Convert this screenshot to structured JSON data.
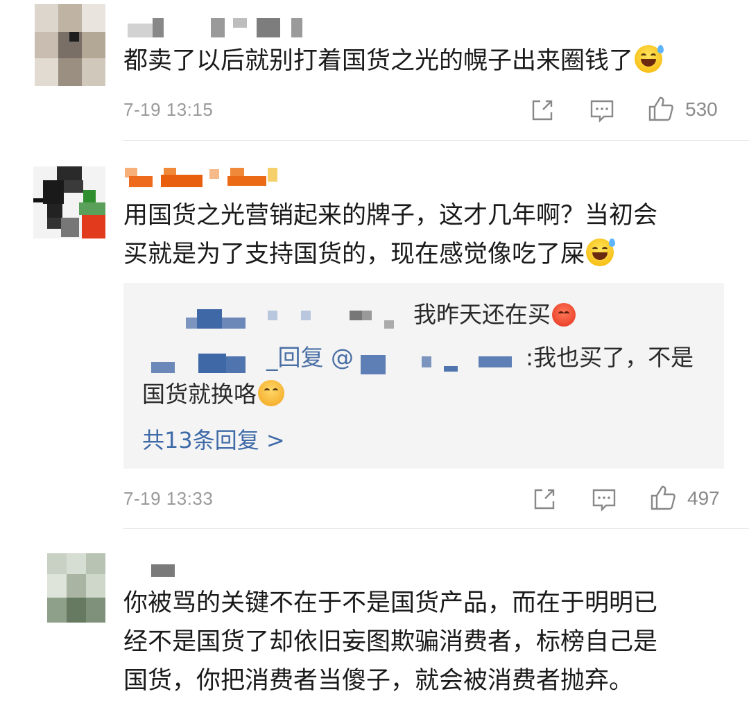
{
  "comments": [
    {
      "text": "都卖了以后就别打着国货之光的幌子出来圈钱了",
      "time": "7-19 13:15",
      "likes": "530",
      "emoji": "grinning-sweat"
    },
    {
      "text_line1": "用国货之光营销起来的牌子，这才几年啊？当初会",
      "text_line2": "买就是为了支持国货的，现在感觉像吃了屎",
      "time": "7-19 13:33",
      "likes": "497",
      "emoji": "grinning-sweat",
      "replies": {
        "reply1_text": "我昨天还在买",
        "reply2_prefix": "_回复 @",
        "reply2_text": ":我也买了，不是",
        "reply2_line2": "国货就换咯",
        "more_label": "共13条回复 >"
      }
    },
    {
      "text_line1": "你被骂的关键不在于不是国货产品，而在于明明已",
      "text_line2": "经不是国货了却依旧妄图欺骗消费者，标榜自己是",
      "text_line3": "国货，你把消费者当傻子，就会被消费者抛弃。"
    }
  ],
  "icons": {
    "share": "share-icon",
    "comment": "comment-icon",
    "like": "thumbs-up-icon"
  }
}
